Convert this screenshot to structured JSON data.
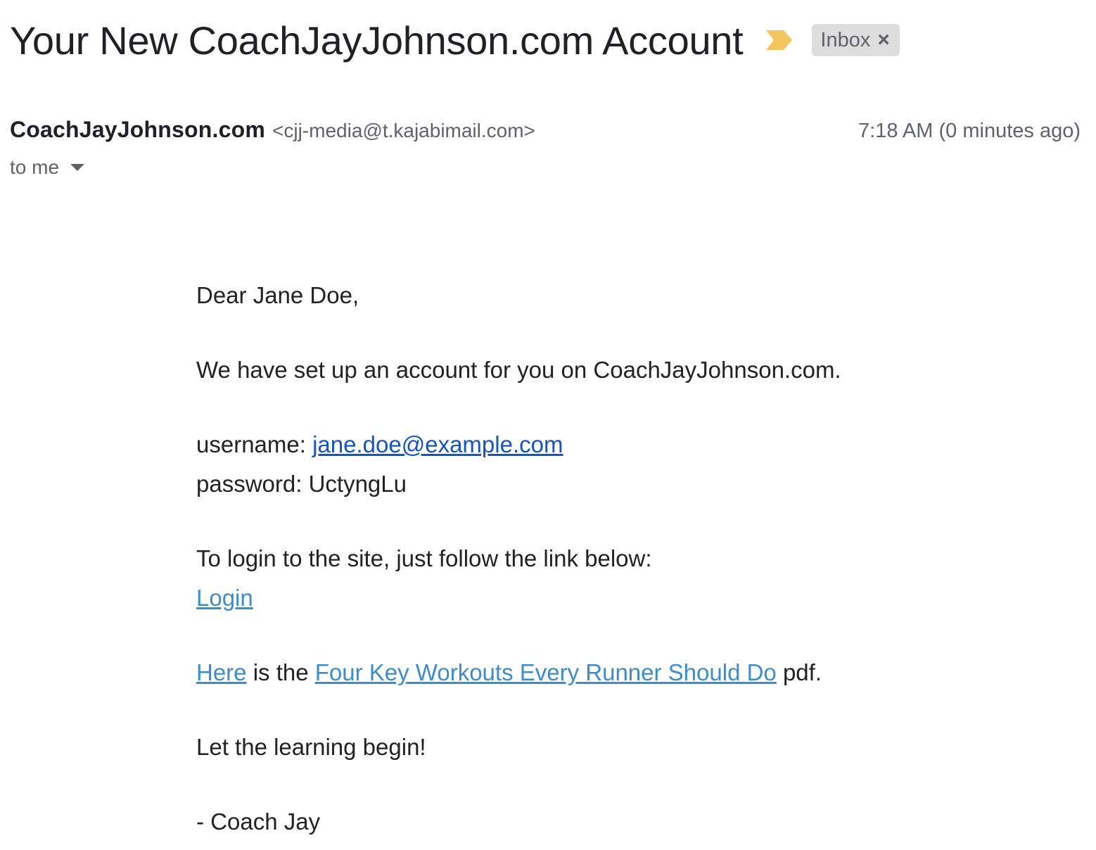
{
  "email": {
    "subject": "Your New CoachJayJohnson.com Account",
    "label": "Inbox",
    "label_close": "×",
    "sender_name": "CoachJayJohnson.com",
    "sender_email": "<cjj-media@t.kajabimail.com>",
    "timestamp": "7:18 AM (0 minutes ago)",
    "recipient": "to me"
  },
  "body": {
    "greeting": "Dear Jane Doe,",
    "intro": "We have set up an account for you on CoachJayJohnson.com.",
    "username_label": "username: ",
    "username_value": "jane.doe@example.com",
    "password_label": "password: ",
    "password_value": "UctyngLu",
    "login_instruction": "To login to the site, just follow the link below:",
    "login_link": "Login",
    "pdf_here_link": "Here",
    "pdf_middle_text": " is the ",
    "pdf_title_link": "Four Key Workouts Every Runner Should Do",
    "pdf_suffix": " pdf.",
    "closing": "Let the learning begin!",
    "signature": "- Coach Jay"
  },
  "colors": {
    "importance_marker": "#f4c55b",
    "link_primary": "#1155cc",
    "link_secondary": "#3a8dd5",
    "chip_bg": "#dddddd"
  },
  "icons": {
    "importance": "importance-marker-icon",
    "close": "close-icon",
    "dropdown": "chevron-down-icon"
  }
}
